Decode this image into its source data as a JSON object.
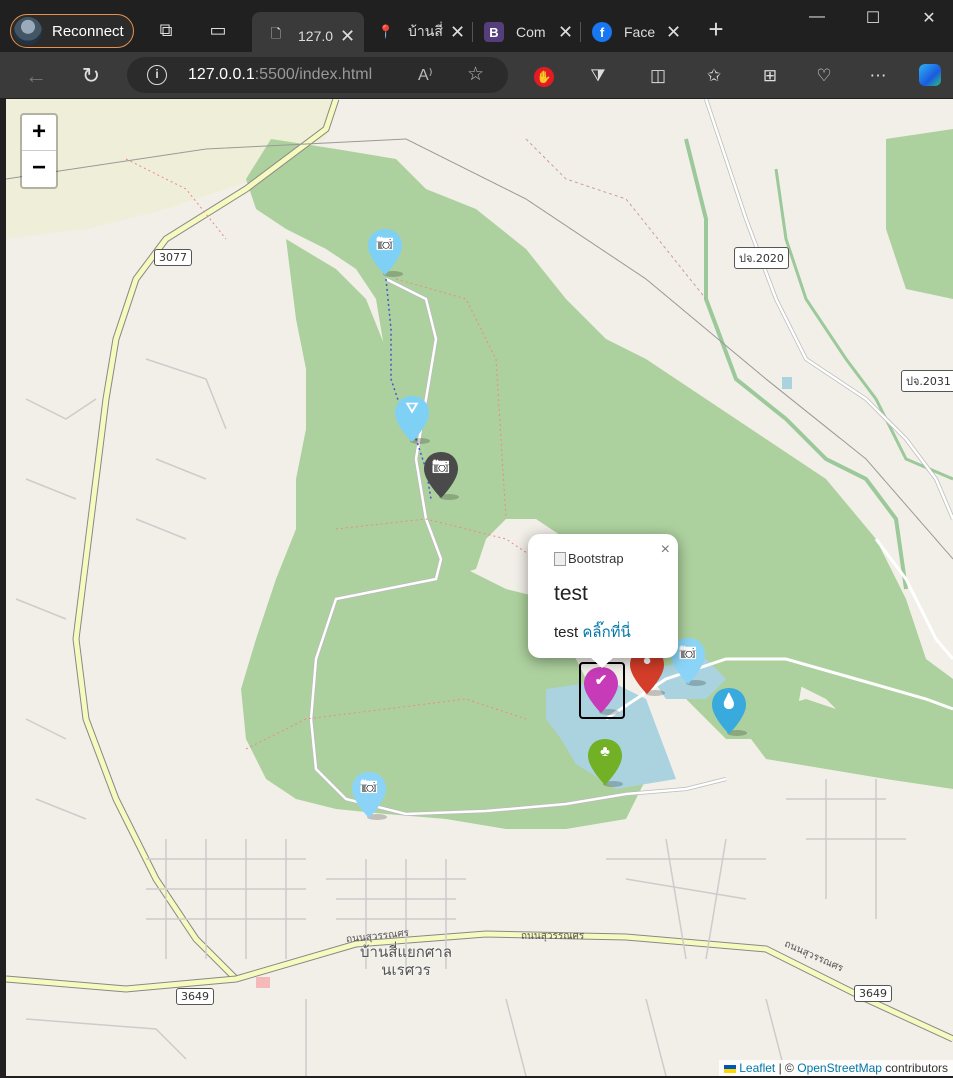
{
  "browser": {
    "profile_label": "Reconnect",
    "tabs": [
      {
        "title": "127.0",
        "icon": "document-icon",
        "active": true
      },
      {
        "title": "บ้านสี่",
        "icon": "google-maps-icon",
        "active": false
      },
      {
        "title": "Com",
        "icon": "bootstrap-icon",
        "active": false
      },
      {
        "title": "Face",
        "icon": "facebook-icon",
        "active": false
      }
    ],
    "url_host": "127.0.0.1",
    "url_path": ":5500/index.html"
  },
  "map": {
    "zoom_in_label": "+",
    "zoom_out_label": "−",
    "road_shields": [
      "3077",
      "ปจ.2020",
      "ปจ.2031",
      "3649",
      "3649"
    ],
    "road_labels": [
      "ถนนสุวรรณศร",
      "ถนนสุวรรณศร",
      "ถนนสุวรรณศร"
    ],
    "place_label_line1": "บ้านสี่แยกศาล",
    "place_label_line2": "นเรศวร",
    "markers": [
      {
        "icon": "camera-icon",
        "color": "#7fd0f5"
      },
      {
        "icon": "road-icon",
        "color": "#7fd0f5"
      },
      {
        "icon": "camera-icon",
        "color": "#4a4a4a"
      },
      {
        "icon": "check-icon",
        "color": "#c73bb9"
      },
      {
        "icon": "map-pin-icon",
        "color": "#d33d29"
      },
      {
        "icon": "camera-icon",
        "color": "#8bd4f7"
      },
      {
        "icon": "water-drop-icon",
        "color": "#38aadd"
      },
      {
        "icon": "tree-icon",
        "color": "#72b026"
      },
      {
        "icon": "camera-icon",
        "color": "#8bd4f7"
      }
    ],
    "popup": {
      "image_alt": "Bootstrap",
      "heading": "test",
      "text": "test",
      "link": "คลิ๊กที่นี่",
      "close": "×"
    },
    "attribution": {
      "leaflet": "Leaflet",
      "sep": "| ©",
      "osm": "OpenStreetMap",
      "suffix": "contributors"
    }
  }
}
